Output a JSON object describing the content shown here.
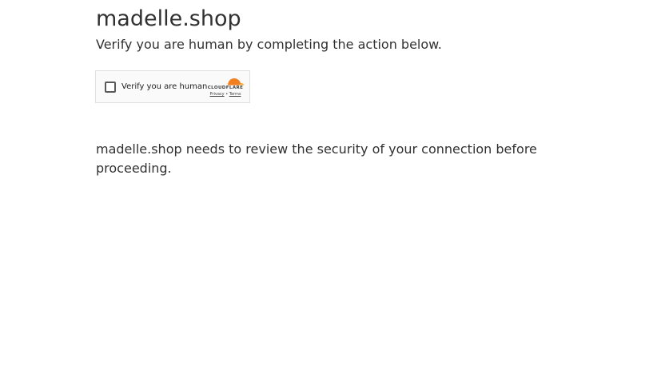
{
  "page": {
    "title": "madelle.shop",
    "subtitle": "Verify you are human by completing the action below.",
    "message": "madelle.shop needs to review the security of your connection before proceeding."
  },
  "widget": {
    "checkbox_label": "Verify you are human",
    "brand": "CLOUDFLARE",
    "privacy_label": "Privacy",
    "separator": "•",
    "terms_label": "Terms",
    "logo_icon": "cloudflare-cloud-icon",
    "brand_color": "#f38020"
  }
}
